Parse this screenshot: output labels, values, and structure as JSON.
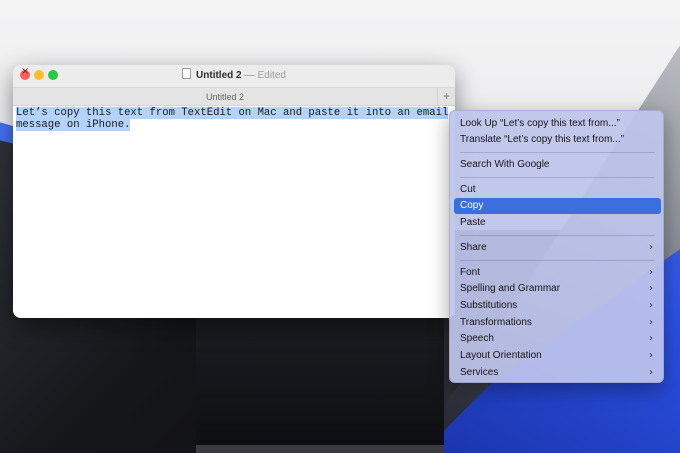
{
  "window": {
    "title": "Untitled 2",
    "separator": "—",
    "status": "Edited",
    "tab_label": "Untitled 2",
    "tab_add": "+",
    "document_lines": [
      "Let’s copy this text from TextEdit on Mac and paste it into an email",
      "message on iPhone."
    ]
  },
  "context_menu": {
    "items": [
      {
        "label": "Look Up “Let’s copy this text from...”",
        "submenu": false
      },
      {
        "label": "Translate “Let’s copy this text from...”",
        "submenu": false
      },
      {
        "label": "Search With Google",
        "submenu": false
      },
      {
        "label": "Cut",
        "submenu": false
      },
      {
        "label": "Copy",
        "submenu": false,
        "highlighted": true
      },
      {
        "label": "Paste",
        "submenu": false
      },
      {
        "label": "Share",
        "submenu": true
      },
      {
        "label": "Font",
        "submenu": true
      },
      {
        "label": "Spelling and Grammar",
        "submenu": true
      },
      {
        "label": "Substitutions",
        "submenu": true
      },
      {
        "label": "Transformations",
        "submenu": true
      },
      {
        "label": "Speech",
        "submenu": true
      },
      {
        "label": "Layout Orientation",
        "submenu": true
      },
      {
        "label": "Services",
        "submenu": true
      }
    ],
    "submenu_glyph": "›"
  },
  "colors": {
    "highlight": "#3b6fde",
    "selection": "#b3d3fb"
  }
}
